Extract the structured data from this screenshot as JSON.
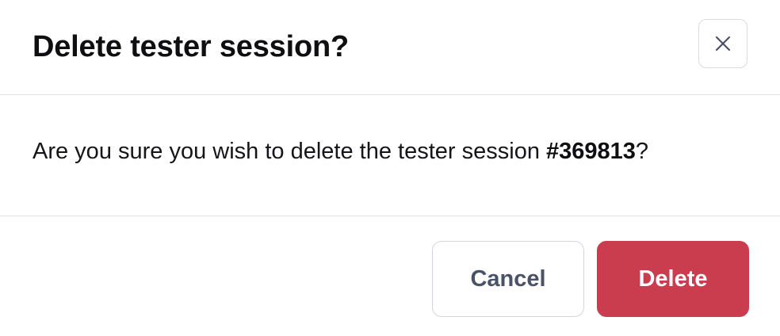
{
  "dialog": {
    "title": "Delete tester session?",
    "close_icon": "close-icon",
    "message_prefix": "Are you sure you wish to delete the tester session ",
    "session_id": "#369813",
    "message_suffix": "?",
    "cancel_label": "Cancel",
    "delete_label": "Delete"
  },
  "colors": {
    "danger": "#c93d4f",
    "cancel_text": "#4a5268",
    "divider": "#dedfe3"
  }
}
